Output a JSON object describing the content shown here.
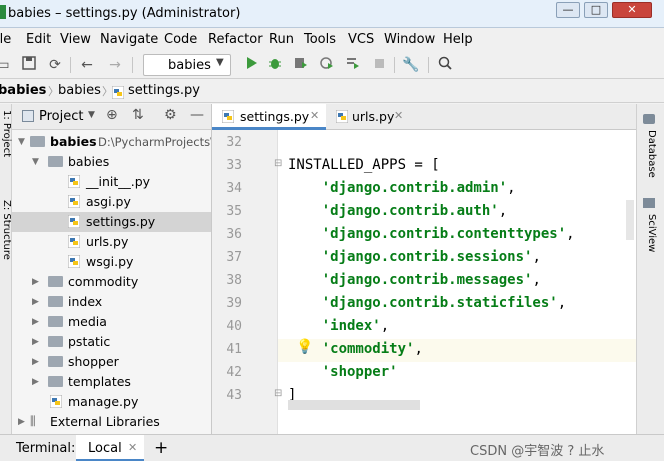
{
  "window": {
    "title": "babies – settings.py (Administrator)",
    "min_glyph": "—",
    "max_glyph": "□",
    "close_glyph": "✕"
  },
  "menu": [
    "ile",
    "Edit",
    "View",
    "Navigate",
    "Code",
    "Refactor",
    "Run",
    "Tools",
    "VCS",
    "Window",
    "Help"
  ],
  "toolbar": {
    "run_config": "babies",
    "dropdown_glyph": "▼"
  },
  "breadcrumb": [
    "babies",
    "babies",
    "settings.py"
  ],
  "left_strip": {
    "project_label": "1: Project",
    "structure_label": "Z: Structure"
  },
  "project_panel": {
    "header": "Project",
    "root_name": "babies",
    "root_path": "D:\\PycharmProjects\\",
    "tree": [
      {
        "label": "babies",
        "type": "folder",
        "depth": 1,
        "expanded": true
      },
      {
        "label": "__init__.py",
        "type": "py",
        "depth": 2
      },
      {
        "label": "asgi.py",
        "type": "py",
        "depth": 2
      },
      {
        "label": "settings.py",
        "type": "py",
        "depth": 2,
        "selected": true
      },
      {
        "label": "urls.py",
        "type": "py",
        "depth": 2
      },
      {
        "label": "wsgi.py",
        "type": "py",
        "depth": 2
      },
      {
        "label": "commodity",
        "type": "folder",
        "depth": 1
      },
      {
        "label": "index",
        "type": "folder",
        "depth": 1
      },
      {
        "label": "media",
        "type": "folder",
        "depth": 1
      },
      {
        "label": "pstatic",
        "type": "folder",
        "depth": 1
      },
      {
        "label": "shopper",
        "type": "folder",
        "depth": 1
      },
      {
        "label": "templates",
        "type": "folder",
        "depth": 1
      },
      {
        "label": "manage.py",
        "type": "py",
        "depth": 1
      }
    ],
    "external_libraries": "External Libraries"
  },
  "tabs": [
    {
      "label": "settings.py",
      "active": true
    },
    {
      "label": "urls.py",
      "active": false
    }
  ],
  "editor": {
    "lines": [
      {
        "num": "32",
        "parts": []
      },
      {
        "num": "33",
        "parts": [
          {
            "t": "INSTALLED_APPS = [",
            "s": false
          }
        ]
      },
      {
        "num": "34",
        "parts": [
          {
            "t": "    ",
            "s": false
          },
          {
            "t": "'django.contrib.admin'",
            "s": true
          },
          {
            "t": ",",
            "s": false
          }
        ]
      },
      {
        "num": "35",
        "parts": [
          {
            "t": "    ",
            "s": false
          },
          {
            "t": "'django.contrib.auth'",
            "s": true
          },
          {
            "t": ",",
            "s": false
          }
        ]
      },
      {
        "num": "36",
        "parts": [
          {
            "t": "    ",
            "s": false
          },
          {
            "t": "'django.contrib.contenttypes'",
            "s": true
          },
          {
            "t": ",",
            "s": false
          }
        ]
      },
      {
        "num": "37",
        "parts": [
          {
            "t": "    ",
            "s": false
          },
          {
            "t": "'django.contrib.sessions'",
            "s": true
          },
          {
            "t": ",",
            "s": false
          }
        ]
      },
      {
        "num": "38",
        "parts": [
          {
            "t": "    ",
            "s": false
          },
          {
            "t": "'django.contrib.messages'",
            "s": true
          },
          {
            "t": ",",
            "s": false
          }
        ]
      },
      {
        "num": "39",
        "parts": [
          {
            "t": "    ",
            "s": false
          },
          {
            "t": "'django.contrib.staticfiles'",
            "s": true
          },
          {
            "t": ",",
            "s": false
          }
        ]
      },
      {
        "num": "40",
        "parts": [
          {
            "t": "    ",
            "s": false
          },
          {
            "t": "'index'",
            "s": true
          },
          {
            "t": ",",
            "s": false
          }
        ]
      },
      {
        "num": "41",
        "parts": [
          {
            "t": "    ",
            "s": false
          },
          {
            "t": "'commodity'",
            "s": true
          },
          {
            "t": ",",
            "s": false
          }
        ],
        "current": true
      },
      {
        "num": "42",
        "parts": [
          {
            "t": "    ",
            "s": false
          },
          {
            "t": "'shopper'",
            "s": true
          }
        ]
      },
      {
        "num": "43",
        "parts": [
          {
            "t": "]",
            "s": false
          }
        ]
      }
    ]
  },
  "right_strip": {
    "database_label": "Database",
    "sciview_label": "SciView"
  },
  "bottom": {
    "terminal_label": "Terminal:",
    "local_tab": "Local",
    "add_glyph": "+",
    "watermark": "CSDN @宇智波 ? 止水"
  },
  "colors": {
    "string": "#067d17",
    "active_tab_underline": "#4a86c7",
    "run_green": "#3c9a3c",
    "current_line": "#fcfaed"
  },
  "icons": {
    "save": "save-icon",
    "sync": "sync-icon",
    "back": "back-arrow-icon",
    "forward": "forward-arrow-icon",
    "run": "run-icon",
    "debug": "debug-icon",
    "coverage": "coverage-icon",
    "profile": "profile-icon",
    "build": "build-icon",
    "stop": "stop-icon",
    "settings": "wrench-icon",
    "search": "search-icon",
    "bulb": "lightbulb-icon"
  }
}
